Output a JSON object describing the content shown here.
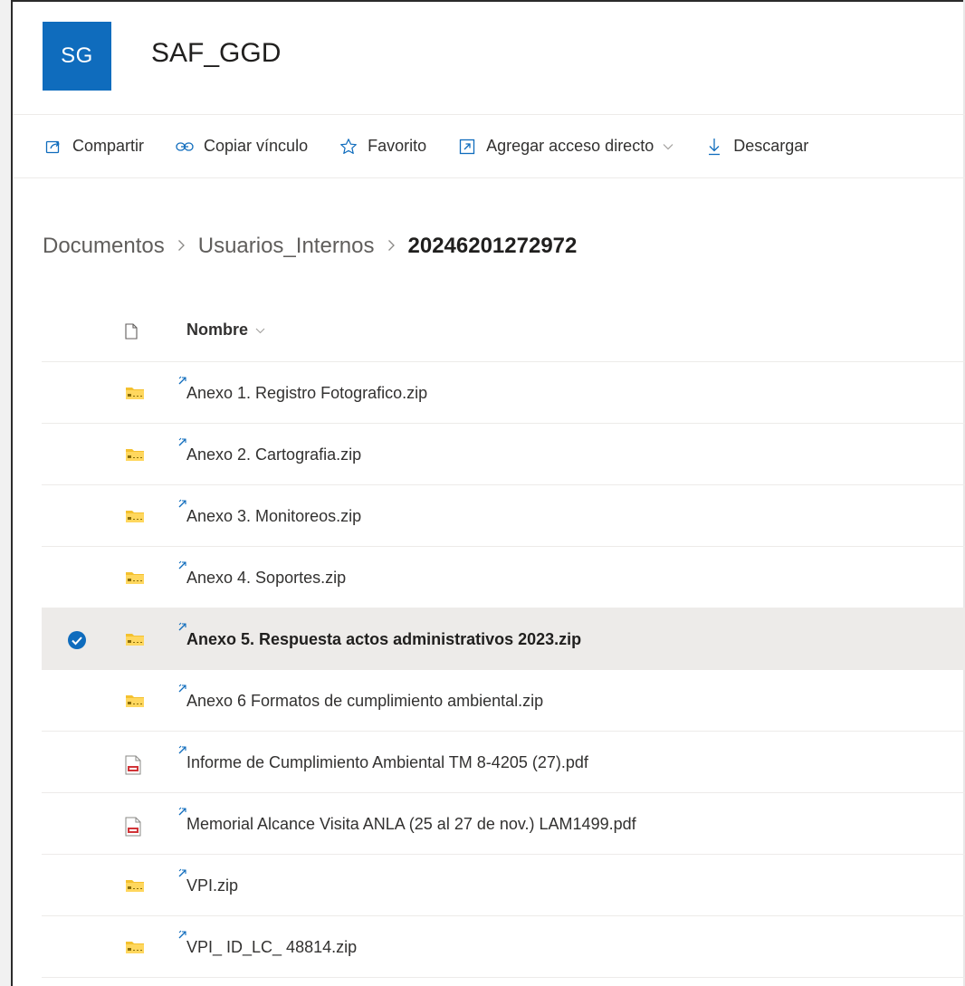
{
  "site": {
    "logo_initials": "SG",
    "title": "SAF_GGD",
    "brand_color": "#0f6cbd"
  },
  "commands": [
    {
      "label": "Compartir",
      "icon": "share-icon"
    },
    {
      "label": "Copiar vínculo",
      "icon": "link-icon"
    },
    {
      "label": "Favorito",
      "icon": "star-icon"
    },
    {
      "label": "Agregar acceso directo",
      "icon": "shortcut-icon",
      "has_dropdown": true
    },
    {
      "label": "Descargar",
      "icon": "download-icon"
    }
  ],
  "breadcrumb": {
    "items": [
      "Documentos",
      "Usuarios_Internos"
    ],
    "current": "20246201272972"
  },
  "list": {
    "column_name": "Nombre",
    "files": [
      {
        "name": "Anexo 1. Registro Fotografico.zip",
        "type": "zip",
        "selected": false
      },
      {
        "name": "Anexo 2. Cartografia.zip",
        "type": "zip",
        "selected": false
      },
      {
        "name": "Anexo 3. Monitoreos.zip",
        "type": "zip",
        "selected": false
      },
      {
        "name": "Anexo 4. Soportes.zip",
        "type": "zip",
        "selected": false
      },
      {
        "name": "Anexo 5. Respuesta actos administrativos 2023.zip",
        "type": "zip",
        "selected": true
      },
      {
        "name": "Anexo 6 Formatos de cumplimiento ambiental.zip",
        "type": "zip",
        "selected": false
      },
      {
        "name": "Informe de Cumplimiento Ambiental TM 8-4205 (27).pdf",
        "type": "pdf",
        "selected": false
      },
      {
        "name": "Memorial Alcance Visita ANLA (25 al 27 de nov.) LAM1499.pdf",
        "type": "pdf",
        "selected": false
      },
      {
        "name": "VPI.zip",
        "type": "zip",
        "selected": false
      },
      {
        "name": "VPI_ ID_LC_ 48814.zip",
        "type": "zip",
        "selected": false
      }
    ]
  }
}
